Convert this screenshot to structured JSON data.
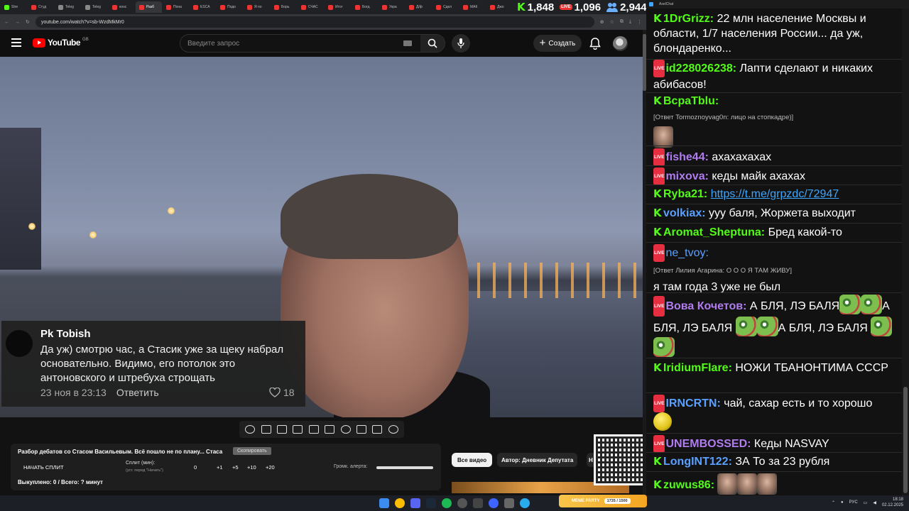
{
  "browser": {
    "tabs": [
      {
        "label": "Stre",
        "color": "#53fc18"
      },
      {
        "label": "Студ",
        "color": "#e33"
      },
      {
        "label": "Teleg",
        "color": "#888"
      },
      {
        "label": "Teleg",
        "color": "#888"
      },
      {
        "label": "конс",
        "color": "#e33"
      },
      {
        "label": "Разб",
        "color": "#e33"
      },
      {
        "label": "Пона",
        "color": "#e33"
      },
      {
        "label": "ESCA",
        "color": "#e33"
      },
      {
        "label": "Подо",
        "color": "#e33"
      },
      {
        "label": "Я по",
        "color": "#e33"
      },
      {
        "label": "Борь",
        "color": "#e33"
      },
      {
        "label": "СЧАС",
        "color": "#e33"
      },
      {
        "label": "Итог",
        "color": "#e33"
      },
      {
        "label": "Богд",
        "color": "#e33"
      },
      {
        "label": "Укра",
        "color": "#e33"
      },
      {
        "label": "Д/ф",
        "color": "#e33"
      },
      {
        "label": "Сдел",
        "color": "#e33"
      },
      {
        "label": "МАК",
        "color": "#e33"
      },
      {
        "label": "Джо",
        "color": "#e33"
      }
    ],
    "url": "youtube.com/watch?v=sb-WzdMkMr0"
  },
  "counters": {
    "kick": "1,848",
    "live": "1,096",
    "viewers": "2,944"
  },
  "youtube": {
    "logo": "YouTube",
    "region": "GB",
    "search_placeholder": "Введите запрос",
    "create_label": "Создать"
  },
  "comment": {
    "author": "Pk Tobish",
    "text": "Да уж) смотрю час, а Стасик уже за щеку набрал основательно. Видимо, его потолок это антоновского и штребуха строщать",
    "time": "23 ноя в 23:13",
    "reply_label": "Ответить",
    "likes": "18"
  },
  "split_panel": {
    "title": "Разбор дебатов со Стасом Васильевым. Всё пошло не по плану... Стаса",
    "copy_label": "Скопировать",
    "start_label": "НАЧАТЬ СПЛИТ",
    "split_label": "Сплит (мин):",
    "split_sub": "(уст. перед \"Начать\")",
    "values": [
      "0",
      "+1",
      "+5",
      "+10",
      "+20"
    ],
    "alert_label": "Громк. алерта:",
    "stats": "Выкуплено: 0 / Всего: ? минут"
  },
  "chips": {
    "all": "Все видео",
    "author": "Автор: Дневник Депутата",
    "more": "Н"
  },
  "chat": {
    "window_title": "AxelChat",
    "messages": [
      {
        "platform": "kick",
        "user": "1DrGrizz",
        "color": "#53fc18",
        "text": "22 млн население Москвы и области, 1/7 населения России... да уж, блондаренко..."
      },
      {
        "platform": "live",
        "user": "id228026238",
        "color": "#53fc18",
        "text": "Лапти сделают и никаких абибасов!"
      },
      {
        "platform": "kick",
        "user": "BcpaTblu",
        "color": "#53fc18",
        "reply": "[Ответ Tormoznoyvag0n: лицо на стопкадре)]",
        "text": ""
      },
      {
        "platform": "live",
        "user": "fishe44",
        "color": "#b07cf0",
        "text": "ахахахахах"
      },
      {
        "platform": "live",
        "user": "mixova",
        "color": "#b07cf0",
        "text": "кеды майк ахахах"
      },
      {
        "platform": "kick",
        "user": "Ryba21",
        "color": "#53fc18",
        "text": "https://t.me/grpzdc/72947"
      },
      {
        "platform": "kick",
        "user": "volkiax",
        "color": "#5aa0ff",
        "text": "ууу баля, Жоржета выходит"
      },
      {
        "platform": "kick",
        "user": "Aromat_Sheptuna",
        "color": "#53fc18",
        "text": "Бред какой-то"
      },
      {
        "platform": "live",
        "user": "ne_tvoy",
        "color": "#5aa0ff",
        "reply": "[Ответ Лилия Агарина: О О О Я ТАМ ЖИВУ]",
        "text": "я там года 3 уже не был"
      },
      {
        "platform": "live",
        "user": "Вова Кочетов",
        "color": "#b07cf0",
        "text": "А БЛЯ, ЛЭ БАЛЯ"
      },
      {
        "platform": "kick",
        "user": "IridiumFlare",
        "color": "#53fc18",
        "text": "НОЖИ ТБАНОНТИМА СССР"
      },
      {
        "platform": "live",
        "user": "IRNCRTN",
        "color": "#5aa0ff",
        "text": "чай, сахар есть и то хорошо"
      },
      {
        "platform": "live",
        "user": "UNEMBOSSED",
        "color": "#b07cf0",
        "text": "Кеды NASVAY"
      },
      {
        "platform": "kick",
        "user": "LongINT122",
        "color": "#5aa0ff",
        "text": "ЗА То за 23 рубля"
      },
      {
        "platform": "kick",
        "user": "zuwus86",
        "color": "#53fc18",
        "text": ""
      }
    ],
    "repeat_text": "А БЛЯ, ЛЭ БАЛЯ"
  },
  "taskbar": {
    "lang": "РУС",
    "time": "18:18",
    "date": "02.12.2025",
    "meme_label": "MEME PARTY",
    "meme_progress": "1735 / 1500"
  }
}
